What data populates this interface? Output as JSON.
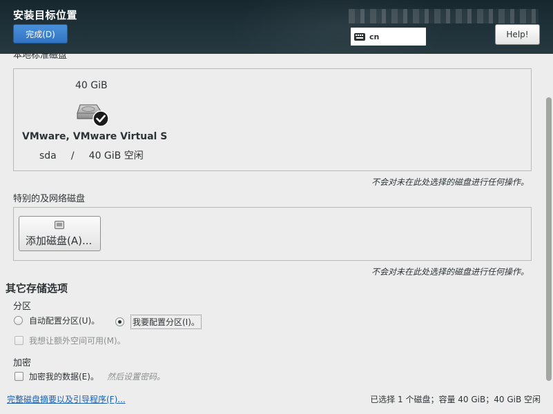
{
  "window": {
    "title": "安装目标位置",
    "done_label": "完成(D)",
    "keyboard_layout": "cn",
    "help_label": "Help!"
  },
  "local_disks": {
    "section_label": "本地标准磁盘",
    "disks": [
      {
        "capacity": "40 GiB",
        "name": "VMware, VMware Virtual S",
        "device": "sda",
        "separator": "/",
        "free": "40 GiB 空闲",
        "selected": true
      }
    ],
    "note": "不会对未在此处选择的磁盘进行任何操作。"
  },
  "special_disks": {
    "section_label": "特别的及网络磁盘",
    "add_disk_label": "添加磁盘(A)...",
    "note": "不会对未在此处选择的磁盘进行任何操作。"
  },
  "other_options": {
    "title": "其它存储选项",
    "partitioning": {
      "label": "分区",
      "auto_label": "自动配置分区(U)。",
      "manual_label": "我要配置分区(I)。",
      "selected": "manual",
      "extra_space_label": "我想让额外空间可用(M)。"
    },
    "encryption": {
      "label": "加密",
      "encrypt_label": "加密我的数据(E)。",
      "hint": "然后设置密码。"
    }
  },
  "footer": {
    "summary_link": "完整磁盘摘要以及引导程序(F)...",
    "status": "已选择 1 个磁盘；容量 40 GiB；40 GiB 空闲"
  }
}
